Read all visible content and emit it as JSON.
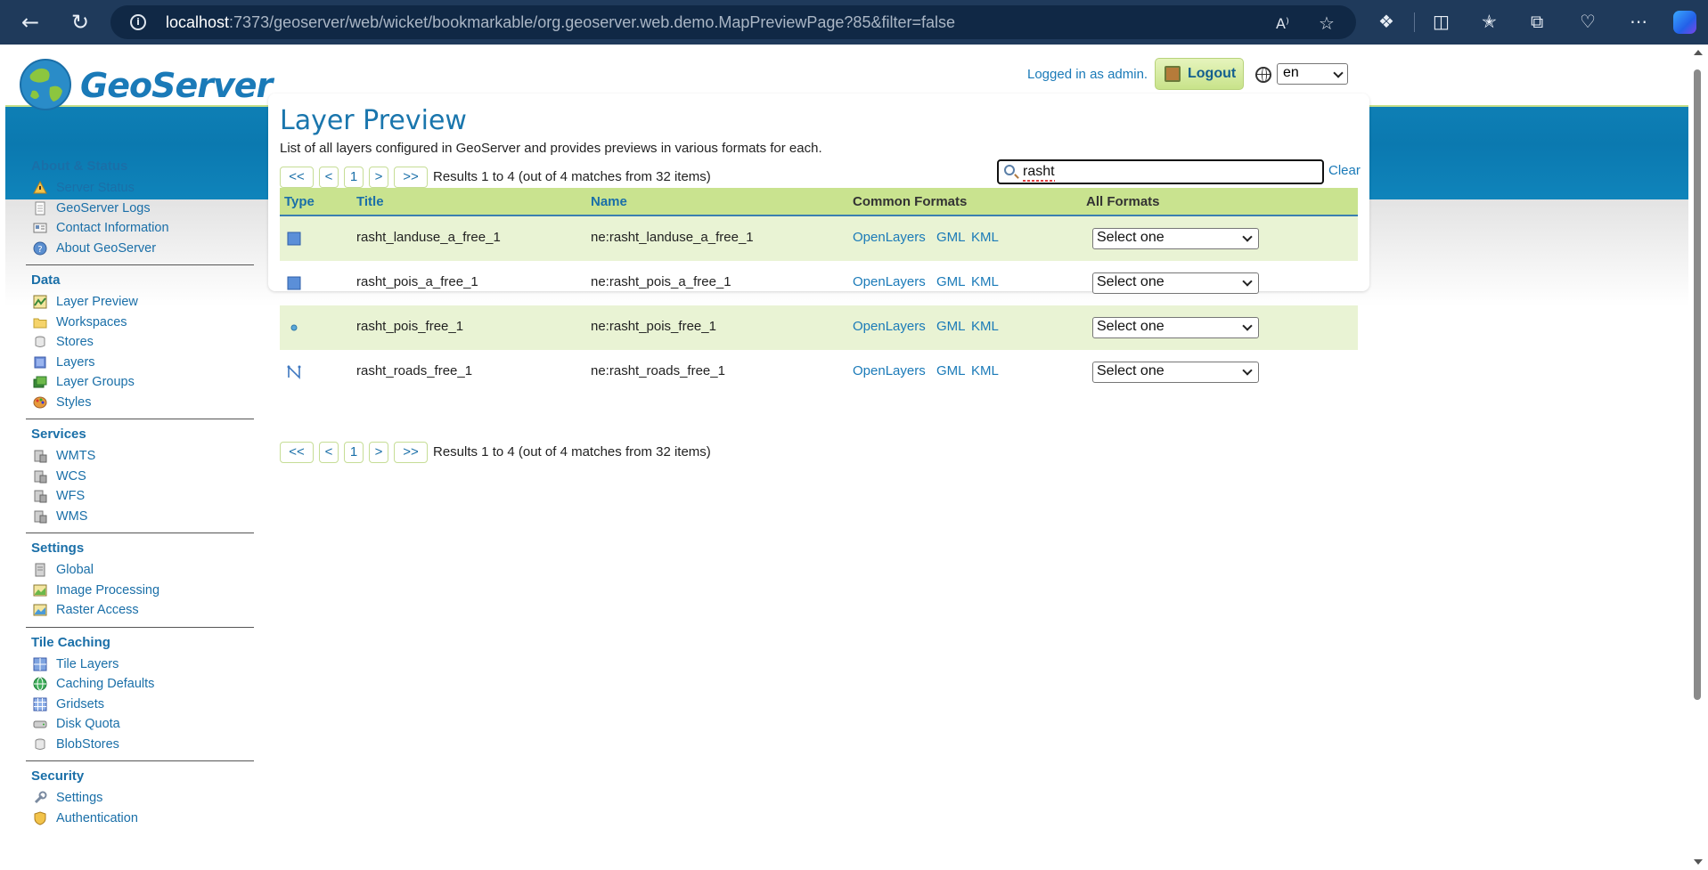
{
  "browser": {
    "url_host": "localhost",
    "url_rest": ":7373/geoserver/web/wicket/bookmarkable/org.geoserver.web.demo.MapPreviewPage?85&filter=false"
  },
  "header": {
    "logo_text": "GeoServer",
    "login_text": "Logged in as admin.",
    "logout_label": "Logout",
    "language": "en"
  },
  "sidebar": {
    "sections": [
      {
        "title": "About & Status",
        "items": [
          "Server Status",
          "GeoServer Logs",
          "Contact Information",
          "About GeoServer"
        ]
      },
      {
        "title": "Data",
        "items": [
          "Layer Preview",
          "Workspaces",
          "Stores",
          "Layers",
          "Layer Groups",
          "Styles"
        ]
      },
      {
        "title": "Services",
        "items": [
          "WMTS",
          "WCS",
          "WFS",
          "WMS"
        ]
      },
      {
        "title": "Settings",
        "items": [
          "Global",
          "Image Processing",
          "Raster Access"
        ]
      },
      {
        "title": "Tile Caching",
        "items": [
          "Tile Layers",
          "Caching Defaults",
          "Gridsets",
          "Disk Quota",
          "BlobStores"
        ]
      },
      {
        "title": "Security",
        "items": [
          "Settings",
          "Authentication"
        ]
      }
    ]
  },
  "main": {
    "title": "Layer Preview",
    "description": "List of all layers configured in GeoServer and provides previews in various formats for each.",
    "pager": {
      "first": "<<",
      "prev": "<",
      "page": "1",
      "next": ">",
      "last": ">>",
      "results": "Results 1 to 4 (out of 4 matches from 32 items)"
    },
    "search_value": "rasht",
    "clear_label": "Clear",
    "columns": {
      "type": "Type",
      "title": "Title",
      "name": "Name",
      "common": "Common Formats",
      "all": "All Formats"
    },
    "rows": [
      {
        "type": "polygon",
        "title": "rasht_landuse_a_free_1",
        "name": "ne:rasht_landuse_a_free_1",
        "f1": "OpenLayers",
        "f2": "GML",
        "f3": "KML",
        "all": "Select one"
      },
      {
        "type": "polygon",
        "title": "rasht_pois_a_free_1",
        "name": "ne:rasht_pois_a_free_1",
        "f1": "OpenLayers",
        "f2": "GML",
        "f3": "KML",
        "all": "Select one"
      },
      {
        "type": "point",
        "title": "rasht_pois_free_1",
        "name": "ne:rasht_pois_free_1",
        "f1": "OpenLayers",
        "f2": "GML",
        "f3": "KML",
        "all": "Select one"
      },
      {
        "type": "line",
        "title": "rasht_roads_free_1",
        "name": "ne:rasht_roads_free_1",
        "f1": "OpenLayers",
        "f2": "GML",
        "f3": "KML",
        "all": "Select one"
      }
    ]
  },
  "colors": {
    "brand_blue": "#0e7fb5",
    "accent_green": "#c9e38f",
    "link": "#1a7ab8"
  }
}
